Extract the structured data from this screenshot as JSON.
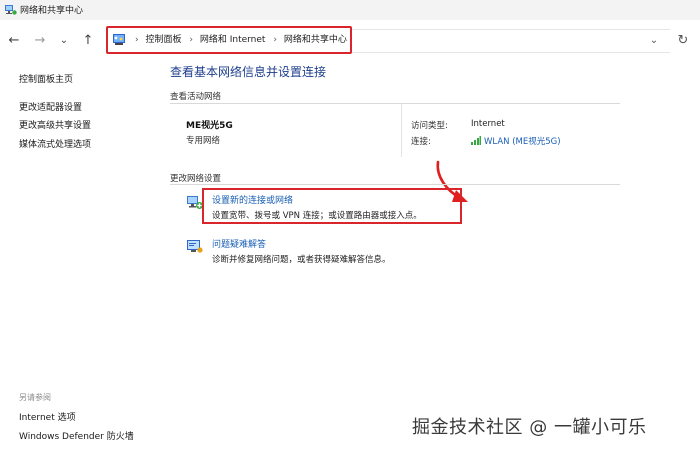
{
  "window": {
    "title": "网络和共享中心"
  },
  "navbar": {
    "back_glyph": "←",
    "forward_glyph": "→",
    "recent_glyph": "⌄",
    "up_glyph": "↑",
    "breadcrumb": [
      "控制面板",
      "网络和 Internet",
      "网络和共享中心"
    ],
    "separator": "›",
    "dropdown_glyph": "⌄",
    "refresh_glyph": "↻"
  },
  "sidebar": {
    "home_link": "控制面板主页",
    "links": [
      "更改适配器设置",
      "更改高级共享设置",
      "媒体流式处理选项"
    ],
    "see_also_label": "另请参阅",
    "see_also_links": [
      "Internet 选项",
      "Windows Defender 防火墙"
    ]
  },
  "main": {
    "title": "查看基本网络信息并设置连接",
    "active_networks_header": "查看活动网络",
    "network": {
      "name": "ME视光5G",
      "type": "专用网络",
      "access_type_label": "访问类型:",
      "access_type_value": "Internet",
      "connection_label": "连接:",
      "connection_value": "WLAN (ME视光5G)"
    },
    "change_settings_header": "更改网络设置",
    "tasks": [
      {
        "link": "设置新的连接或网络",
        "description": "设置宽带、拨号或 VPN 连接；或设置路由器或接入点。",
        "icon": "new-connection-icon"
      },
      {
        "link": "问题疑难解答",
        "description": "诊断并修复网络问题，或者获得疑难解答信息。",
        "icon": "troubleshoot-icon"
      }
    ]
  },
  "watermark": "掘金技术社区 @ 一罐小可乐",
  "colors": {
    "highlight": "#d9262c",
    "link": "#1a5fb4",
    "title": "#1e3e8c"
  }
}
